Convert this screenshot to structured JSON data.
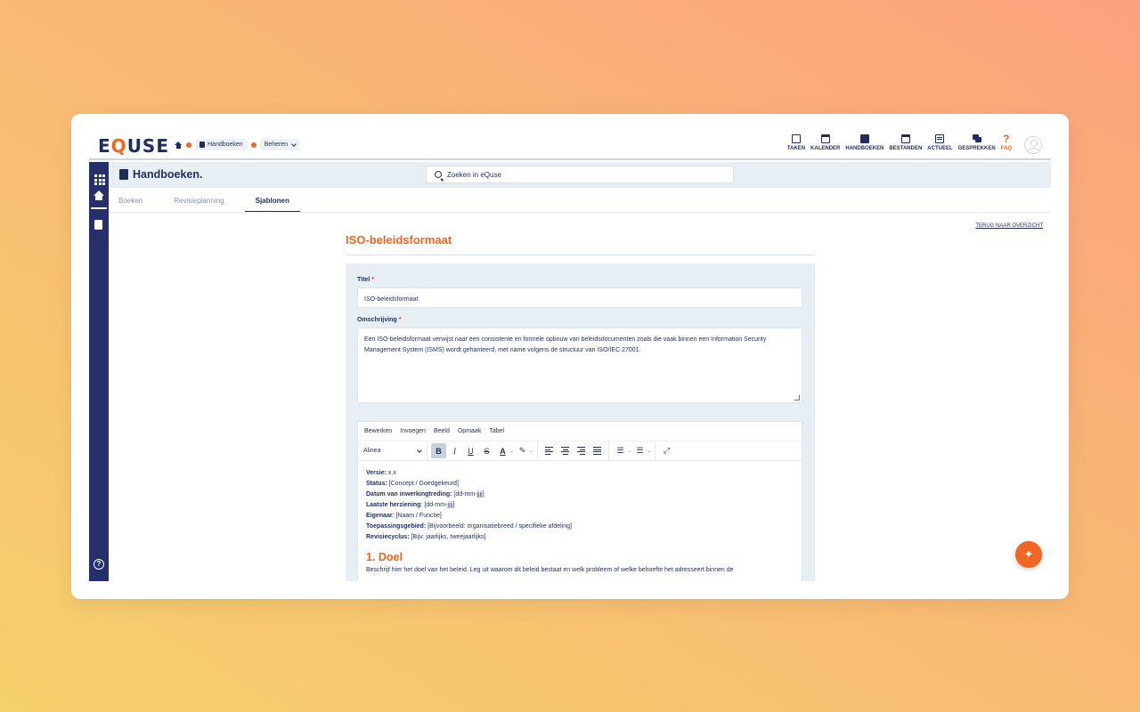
{
  "app": {
    "logo": "EQUSE"
  },
  "breadcrumb": {
    "item1": "Handboeken",
    "item2": "Beheren"
  },
  "topnav": [
    {
      "label": "TAKEN",
      "icon": "clipboard-icon"
    },
    {
      "label": "KALENDER",
      "icon": "calendar-icon"
    },
    {
      "label": "HANDBOEKEN",
      "icon": "book-icon"
    },
    {
      "label": "BESTANDEN",
      "icon": "archive-icon"
    },
    {
      "label": "ACTUEEL",
      "icon": "news-icon"
    },
    {
      "label": "GESPREKKEN",
      "icon": "chat-icon"
    },
    {
      "label": "FAQ",
      "icon": "question-icon"
    }
  ],
  "module": {
    "title": "Handboeken."
  },
  "search": {
    "placeholder": "Zoeken in eQuse"
  },
  "tabs": {
    "t1": "Boeken",
    "t2": "Revisieplanning",
    "t3": "Sjablonen"
  },
  "back_link": "TERUG NAAR OVERZICHT",
  "page_title": "ISO-beleidsformaat",
  "form": {
    "title_label": "Titel",
    "title_value": "ISO-beleidsformaat",
    "desc_label": "Omschrijving",
    "desc_value": "Een ISO-beleidsformaat verwijst naar een consistente en formele opbouw van beleidsdocumenten zoals die vaak binnen een Information Security Management System (ISMS) wordt gehanteerd, met name volgens de structuur van ISO/IEC 27001.",
    "required_mark": "*"
  },
  "editor": {
    "menu": {
      "m1": "Bewerken",
      "m2": "Invoegen",
      "m3": "Beeld",
      "m4": "Opmaak",
      "m5": "Tabel"
    },
    "block_format": "Alinea",
    "fields": [
      {
        "key": "Versie:",
        "value": " x.x"
      },
      {
        "key": "Status:",
        "value": " [Concept / Goedgekeurd]"
      },
      {
        "key": "Datum van inwerkingtreding:",
        "value": " [dd-mm-jjjj]"
      },
      {
        "key": "Laatste herziening",
        "value": ": [dd-mm-jjjj]"
      },
      {
        "key": "Eigenaar",
        "value": ": [Naam / Functie]"
      },
      {
        "key": "Toepassingsgebied:",
        "value": " [Bijvoorbeeld: organisatiebreed / specifieke afdeling]"
      },
      {
        "key": "Revisiecyclus:",
        "value": " [Bijv. jaarlijks, tweejaarlijks]"
      }
    ],
    "heading": "1. Doel",
    "paragraph": "Beschrijf hier het doel van het beleid. Leg uit waarom dit beleid bestaat en welk probleem of welke behoefte het adresseert binnen de"
  },
  "colors": {
    "brand_navy": "#25306a",
    "accent_orange": "#f26522"
  }
}
